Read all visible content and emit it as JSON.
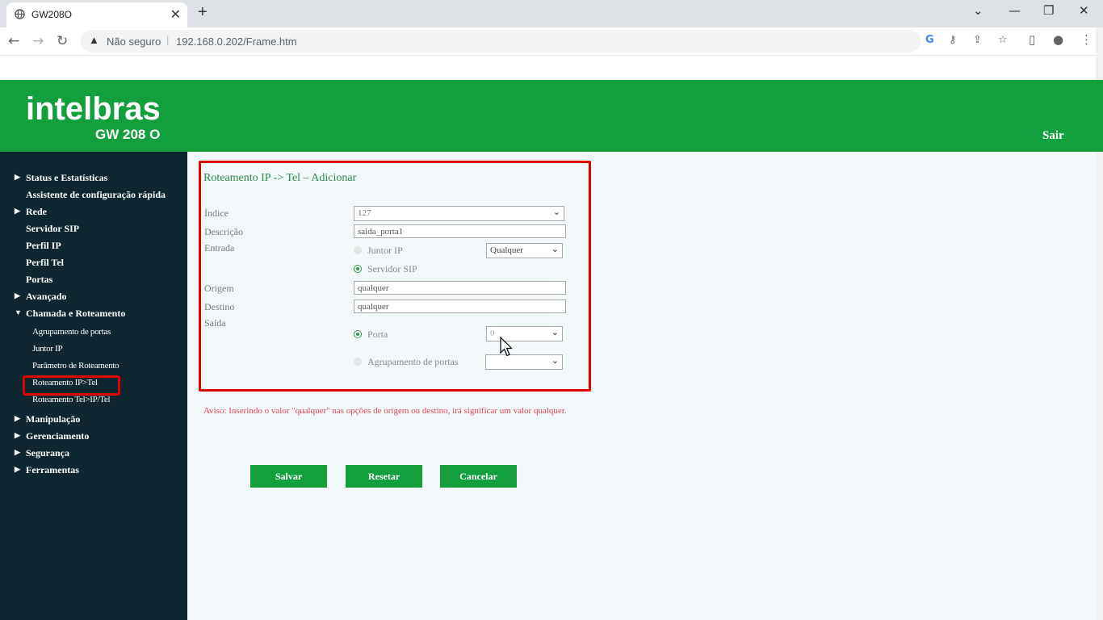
{
  "browser": {
    "tab_title": "GW208O",
    "tab_close": "✕",
    "new_tab": "+",
    "security_label": "Não seguro",
    "url": "192.168.0.202/Frame.htm",
    "window_controls": [
      "⌄",
      "—",
      "❐",
      "✕"
    ]
  },
  "header": {
    "logo_text": "intelbras",
    "model": "GW 208 O",
    "logout": "Sair"
  },
  "sidebar": {
    "items": [
      {
        "label": "Status e Estatísticas",
        "arrow": "▶"
      },
      {
        "label": "Assistente de configuração rápida",
        "arrow": ""
      },
      {
        "label": "Rede",
        "arrow": "▶"
      },
      {
        "label": "Servidor SIP",
        "arrow": ""
      },
      {
        "label": "Perfil IP",
        "arrow": ""
      },
      {
        "label": "Perfil Tel",
        "arrow": ""
      },
      {
        "label": "Portas",
        "arrow": ""
      },
      {
        "label": "Avançado",
        "arrow": "▶"
      },
      {
        "label": "Chamada e Roteamento",
        "arrow": "▼"
      },
      {
        "label": "Manipulação",
        "arrow": "▶"
      },
      {
        "label": "Gerenciamento",
        "arrow": "▶"
      },
      {
        "label": "Segurança",
        "arrow": "▶"
      },
      {
        "label": "Ferramentas",
        "arrow": "▶"
      }
    ],
    "subitems": [
      "Agrupamento de portas",
      "Juntor IP",
      "Parâmetro de Roteamento",
      "Roteamento IP>Tel",
      "Roteamento Tel>IP/Tel"
    ]
  },
  "form": {
    "title": "Roteamento IP -> Tel – Adicionar",
    "labels": {
      "indice": "Índice",
      "descricao": "Descrição",
      "entrada": "Entrada",
      "origem": "Origem",
      "destino": "Destino",
      "saida": "Saída"
    },
    "indice_value": "127",
    "descricao_value": "saida_porta1",
    "entrada_options": {
      "juntor_ip": "Juntor IP",
      "servidor_sip": "Servidor SIP",
      "juntor_select": "Qualquer",
      "selected": "Servidor SIP"
    },
    "origem_value": "qualquer",
    "destino_value": "qualquer",
    "saida_options": {
      "porta": "Porta",
      "agrupamento": "Agrupamento de portas",
      "porta_select": "0",
      "agrupamento_select": "",
      "selected": "Porta"
    }
  },
  "warning": "Aviso: Inserindo o valor \"qualquer\" nas opções de origem ou destino, irá significar um valor qualquer.",
  "buttons": {
    "save": "Salvar",
    "reset": "Resetar",
    "cancel": "Cancelar"
  },
  "colors": {
    "brand_green": "#139f3c",
    "sidebar_bg": "#0e2630",
    "highlight_red": "#e00000"
  }
}
